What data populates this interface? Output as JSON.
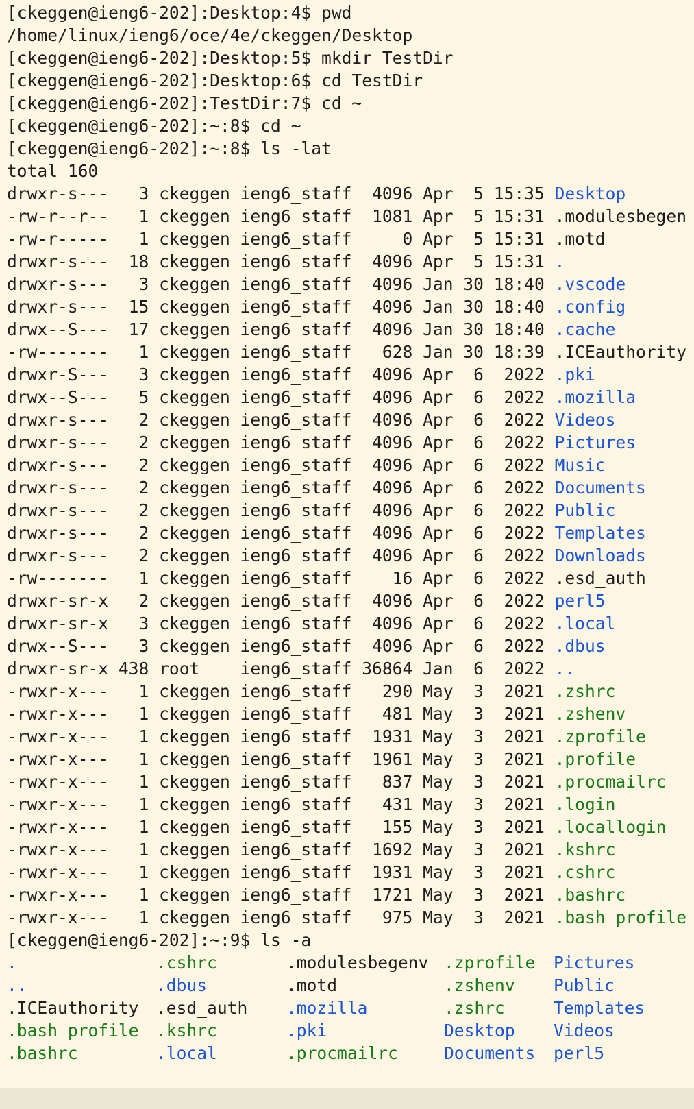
{
  "colors": {
    "background": "#fdf6e3",
    "text": "#1e1e1e",
    "directory": "#1c56d6",
    "executable": "#1b7a1b"
  },
  "history": [
    "[ckeggen@ieng6-202]:Desktop:4$ pwd",
    "/home/linux/ieng6/oce/4e/ckeggen/Desktop",
    "[ckeggen@ieng6-202]:Desktop:5$ mkdir TestDir",
    "[ckeggen@ieng6-202]:Desktop:6$ cd TestDir",
    "[ckeggen@ieng6-202]:TestDir:7$ cd ~",
    "[ckeggen@ieng6-202]:~:8$ cd ~",
    "[ckeggen@ieng6-202]:~:8$ ls -lat",
    "total 160"
  ],
  "listing": [
    {
      "perm": "drwxr-s---",
      "links": "3",
      "owner": "ckeggen",
      "group": "ieng6_staff",
      "size": "4096",
      "month": "Apr",
      "day": "5",
      "time": "15:35",
      "name": "Desktop",
      "kind": "dir"
    },
    {
      "perm": "-rw-r--r--",
      "links": "1",
      "owner": "ckeggen",
      "group": "ieng6_staff",
      "size": "1081",
      "month": "Apr",
      "day": "5",
      "time": "15:31",
      "name": ".modulesbegen",
      "kind": "plain"
    },
    {
      "perm": "-rw-r-----",
      "links": "1",
      "owner": "ckeggen",
      "group": "ieng6_staff",
      "size": "0",
      "month": "Apr",
      "day": "5",
      "time": "15:31",
      "name": ".motd",
      "kind": "plain"
    },
    {
      "perm": "drwxr-s---",
      "links": "18",
      "owner": "ckeggen",
      "group": "ieng6_staff",
      "size": "4096",
      "month": "Apr",
      "day": "5",
      "time": "15:31",
      "name": ".",
      "kind": "dir"
    },
    {
      "perm": "drwxr-s---",
      "links": "3",
      "owner": "ckeggen",
      "group": "ieng6_staff",
      "size": "4096",
      "month": "Jan",
      "day": "30",
      "time": "18:40",
      "name": ".vscode",
      "kind": "dir"
    },
    {
      "perm": "drwxr-s---",
      "links": "15",
      "owner": "ckeggen",
      "group": "ieng6_staff",
      "size": "4096",
      "month": "Jan",
      "day": "30",
      "time": "18:40",
      "name": ".config",
      "kind": "dir"
    },
    {
      "perm": "drwx--S---",
      "links": "17",
      "owner": "ckeggen",
      "group": "ieng6_staff",
      "size": "4096",
      "month": "Jan",
      "day": "30",
      "time": "18:40",
      "name": ".cache",
      "kind": "dir"
    },
    {
      "perm": "-rw-------",
      "links": "1",
      "owner": "ckeggen",
      "group": "ieng6_staff",
      "size": "628",
      "month": "Jan",
      "day": "30",
      "time": "18:39",
      "name": ".ICEauthority",
      "kind": "plain"
    },
    {
      "perm": "drwxr-S---",
      "links": "3",
      "owner": "ckeggen",
      "group": "ieng6_staff",
      "size": "4096",
      "month": "Apr",
      "day": "6",
      "time": "2022",
      "name": ".pki",
      "kind": "dir"
    },
    {
      "perm": "drwx--S---",
      "links": "5",
      "owner": "ckeggen",
      "group": "ieng6_staff",
      "size": "4096",
      "month": "Apr",
      "day": "6",
      "time": "2022",
      "name": ".mozilla",
      "kind": "dir"
    },
    {
      "perm": "drwxr-s---",
      "links": "2",
      "owner": "ckeggen",
      "group": "ieng6_staff",
      "size": "4096",
      "month": "Apr",
      "day": "6",
      "time": "2022",
      "name": "Videos",
      "kind": "dir"
    },
    {
      "perm": "drwxr-s---",
      "links": "2",
      "owner": "ckeggen",
      "group": "ieng6_staff",
      "size": "4096",
      "month": "Apr",
      "day": "6",
      "time": "2022",
      "name": "Pictures",
      "kind": "dir"
    },
    {
      "perm": "drwxr-s---",
      "links": "2",
      "owner": "ckeggen",
      "group": "ieng6_staff",
      "size": "4096",
      "month": "Apr",
      "day": "6",
      "time": "2022",
      "name": "Music",
      "kind": "dir"
    },
    {
      "perm": "drwxr-s---",
      "links": "2",
      "owner": "ckeggen",
      "group": "ieng6_staff",
      "size": "4096",
      "month": "Apr",
      "day": "6",
      "time": "2022",
      "name": "Documents",
      "kind": "dir"
    },
    {
      "perm": "drwxr-s---",
      "links": "2",
      "owner": "ckeggen",
      "group": "ieng6_staff",
      "size": "4096",
      "month": "Apr",
      "day": "6",
      "time": "2022",
      "name": "Public",
      "kind": "dir"
    },
    {
      "perm": "drwxr-s---",
      "links": "2",
      "owner": "ckeggen",
      "group": "ieng6_staff",
      "size": "4096",
      "month": "Apr",
      "day": "6",
      "time": "2022",
      "name": "Templates",
      "kind": "dir"
    },
    {
      "perm": "drwxr-s---",
      "links": "2",
      "owner": "ckeggen",
      "group": "ieng6_staff",
      "size": "4096",
      "month": "Apr",
      "day": "6",
      "time": "2022",
      "name": "Downloads",
      "kind": "dir"
    },
    {
      "perm": "-rw-------",
      "links": "1",
      "owner": "ckeggen",
      "group": "ieng6_staff",
      "size": "16",
      "month": "Apr",
      "day": "6",
      "time": "2022",
      "name": ".esd_auth",
      "kind": "plain"
    },
    {
      "perm": "drwxr-sr-x",
      "links": "2",
      "owner": "ckeggen",
      "group": "ieng6_staff",
      "size": "4096",
      "month": "Apr",
      "day": "6",
      "time": "2022",
      "name": "perl5",
      "kind": "dir"
    },
    {
      "perm": "drwxr-sr-x",
      "links": "3",
      "owner": "ckeggen",
      "group": "ieng6_staff",
      "size": "4096",
      "month": "Apr",
      "day": "6",
      "time": "2022",
      "name": ".local",
      "kind": "dir"
    },
    {
      "perm": "drwx--S---",
      "links": "3",
      "owner": "ckeggen",
      "group": "ieng6_staff",
      "size": "4096",
      "month": "Apr",
      "day": "6",
      "time": "2022",
      "name": ".dbus",
      "kind": "dir"
    },
    {
      "perm": "drwxr-sr-x",
      "links": "438",
      "owner": "root",
      "group": "ieng6_staff",
      "size": "36864",
      "month": "Jan",
      "day": "6",
      "time": "2022",
      "name": "..",
      "kind": "dir"
    },
    {
      "perm": "-rwxr-x---",
      "links": "1",
      "owner": "ckeggen",
      "group": "ieng6_staff",
      "size": "290",
      "month": "May",
      "day": "3",
      "time": "2021",
      "name": ".zshrc",
      "kind": "exec"
    },
    {
      "perm": "-rwxr-x---",
      "links": "1",
      "owner": "ckeggen",
      "group": "ieng6_staff",
      "size": "481",
      "month": "May",
      "day": "3",
      "time": "2021",
      "name": ".zshenv",
      "kind": "exec"
    },
    {
      "perm": "-rwxr-x---",
      "links": "1",
      "owner": "ckeggen",
      "group": "ieng6_staff",
      "size": "1931",
      "month": "May",
      "day": "3",
      "time": "2021",
      "name": ".zprofile",
      "kind": "exec"
    },
    {
      "perm": "-rwxr-x---",
      "links": "1",
      "owner": "ckeggen",
      "group": "ieng6_staff",
      "size": "1961",
      "month": "May",
      "day": "3",
      "time": "2021",
      "name": ".profile",
      "kind": "exec"
    },
    {
      "perm": "-rwxr-x---",
      "links": "1",
      "owner": "ckeggen",
      "group": "ieng6_staff",
      "size": "837",
      "month": "May",
      "day": "3",
      "time": "2021",
      "name": ".procmailrc",
      "kind": "exec"
    },
    {
      "perm": "-rwxr-x---",
      "links": "1",
      "owner": "ckeggen",
      "group": "ieng6_staff",
      "size": "431",
      "month": "May",
      "day": "3",
      "time": "2021",
      "name": ".login",
      "kind": "exec"
    },
    {
      "perm": "-rwxr-x---",
      "links": "1",
      "owner": "ckeggen",
      "group": "ieng6_staff",
      "size": "155",
      "month": "May",
      "day": "3",
      "time": "2021",
      "name": ".locallogin",
      "kind": "exec"
    },
    {
      "perm": "-rwxr-x---",
      "links": "1",
      "owner": "ckeggen",
      "group": "ieng6_staff",
      "size": "1692",
      "month": "May",
      "day": "3",
      "time": "2021",
      "name": ".kshrc",
      "kind": "exec"
    },
    {
      "perm": "-rwxr-x---",
      "links": "1",
      "owner": "ckeggen",
      "group": "ieng6_staff",
      "size": "1931",
      "month": "May",
      "day": "3",
      "time": "2021",
      "name": ".cshrc",
      "kind": "exec"
    },
    {
      "perm": "-rwxr-x---",
      "links": "1",
      "owner": "ckeggen",
      "group": "ieng6_staff",
      "size": "1721",
      "month": "May",
      "day": "3",
      "time": "2021",
      "name": ".bashrc",
      "kind": "exec"
    },
    {
      "perm": "-rwxr-x---",
      "links": "1",
      "owner": "ckeggen",
      "group": "ieng6_staff",
      "size": "975",
      "month": "May",
      "day": "3",
      "time": "2021",
      "name": ".bash_profile",
      "kind": "exec"
    }
  ],
  "ls_a_prompt": "[ckeggen@ieng6-202]:~:9$ ls -a",
  "ls_a_grid": [
    [
      {
        "name": ".",
        "kind": "dir"
      },
      {
        "name": ".cshrc",
        "kind": "exec"
      },
      {
        "name": ".modulesbegenv",
        "kind": "plain"
      },
      {
        "name": ".zprofile",
        "kind": "exec"
      },
      {
        "name": "Pictures",
        "kind": "dir"
      }
    ],
    [
      {
        "name": "..",
        "kind": "dir"
      },
      {
        "name": ".dbus",
        "kind": "dir"
      },
      {
        "name": ".motd",
        "kind": "plain"
      },
      {
        "name": ".zshenv",
        "kind": "exec"
      },
      {
        "name": "Public",
        "kind": "dir"
      }
    ],
    [
      {
        "name": ".ICEauthority",
        "kind": "plain"
      },
      {
        "name": ".esd_auth",
        "kind": "plain"
      },
      {
        "name": ".mozilla",
        "kind": "dir"
      },
      {
        "name": ".zshrc",
        "kind": "exec"
      },
      {
        "name": "Templates",
        "kind": "dir"
      }
    ],
    [
      {
        "name": ".bash_profile",
        "kind": "exec"
      },
      {
        "name": ".kshrc",
        "kind": "exec"
      },
      {
        "name": ".pki",
        "kind": "dir"
      },
      {
        "name": "Desktop",
        "kind": "dir"
      },
      {
        "name": "Videos",
        "kind": "dir"
      }
    ],
    [
      {
        "name": ".bashrc",
        "kind": "exec"
      },
      {
        "name": ".local",
        "kind": "dir"
      },
      {
        "name": ".procmailrc",
        "kind": "exec"
      },
      {
        "name": "Documents",
        "kind": "dir"
      },
      {
        "name": "perl5",
        "kind": "dir"
      }
    ]
  ]
}
